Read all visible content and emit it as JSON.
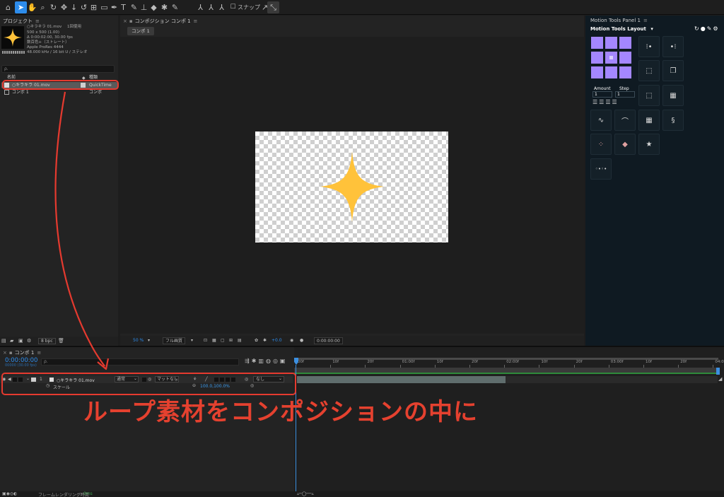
{
  "colors": {
    "accent": "#2d8ceb",
    "annotation": "#e53a2f",
    "star": "#ffc23a",
    "motion_grid": "#a487ff"
  },
  "toolbar": {
    "snap_label": "スナップ"
  },
  "project": {
    "tab_label": "プロジェクト",
    "file_name": "○キラキラ 01.mov",
    "usage": "1回使用",
    "info_lines": [
      "500 x 500 (1.00)",
      "Δ 0:00:02:00, 30.00 fps",
      "数百色+（ストレート）",
      "Apple ProRes 4444",
      "48.000 kHz / 16 bit U / ステレオ"
    ],
    "search_placeholder": "ρ.",
    "col_name": "名前",
    "col_type": "種類",
    "items": [
      {
        "name": "○キラキラ 01.mov",
        "type": "QuickTime"
      },
      {
        "name": "コンポ 1",
        "type": "コンポ"
      }
    ],
    "bpc": "8 bpc"
  },
  "viewer": {
    "tab_label": "コンポジション コンポ 1",
    "sub_tab": "コンポ 1",
    "zoom": "50 %",
    "quality": "フル画質",
    "exposure": "+0.0",
    "timecode": "0:00:00:00"
  },
  "motion_tools": {
    "panel_tab": "Motion Tools Panel 1",
    "title": "Motion Tools Layout",
    "amount_label": "Amount",
    "step_label": "Step",
    "amount_value": "1",
    "step_value": "1"
  },
  "timeline": {
    "tab_label": "コンポ 1",
    "timecode": "0:00:00:00",
    "timecode_sub": "00000 (30.00 fps)",
    "search_placeholder": "ρ.",
    "layer": {
      "index": "1",
      "name": "○キラキラ 01.mov",
      "mode": "通常",
      "matte": "マットなし",
      "parent": "なし",
      "property": "スケール",
      "scale_value": "100.0,100.0%"
    },
    "ticks": [
      "00f",
      "10f",
      "20f",
      "01:00f",
      "10f",
      "20f",
      "02:00f",
      "10f",
      "20f",
      "03:00f",
      "10f",
      "20f",
      "04:0"
    ],
    "footer_label": "フレームレンダリング時間",
    "footer_value": "0ms"
  },
  "annotation": {
    "caption": "ループ素材をコンポジションの中に"
  }
}
